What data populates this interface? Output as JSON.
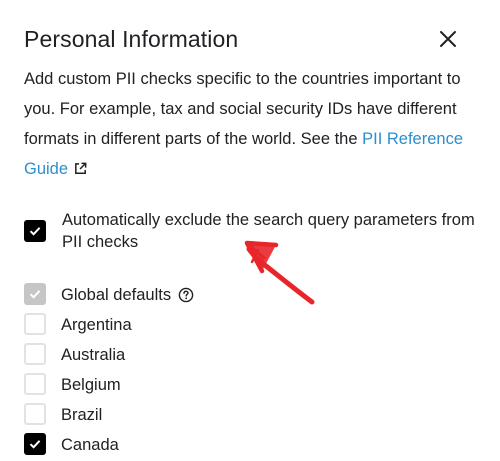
{
  "dialog": {
    "title": "Personal Information",
    "close_icon": "close-icon",
    "description_text": "Add custom PII checks specific to the countries important to you. For example, tax and social security IDs have different formats in different parts of the world. See the ",
    "link_text": "PII Reference Guide",
    "link_icon": "external-link-icon"
  },
  "exclude_option": {
    "label": "Automatically exclude the search query parameters from PII checks",
    "checked": true
  },
  "countries": [
    {
      "label": "Global defaults",
      "state": "checked-disabled",
      "help_icon": "help-circle-icon"
    },
    {
      "label": "Argentina",
      "state": "unchecked"
    },
    {
      "label": "Australia",
      "state": "unchecked"
    },
    {
      "label": "Belgium",
      "state": "unchecked"
    },
    {
      "label": "Brazil",
      "state": "unchecked"
    },
    {
      "label": "Canada",
      "state": "checked"
    }
  ],
  "annotation": {
    "type": "hand-drawn-arrow",
    "color": "#e8262a"
  },
  "colors": {
    "text": "#202124",
    "link": "#2b8fcf",
    "checkbox_checked": "#000000",
    "checkbox_disabled": "#c6c6c6",
    "checkbox_border": "#e2e2e2"
  }
}
